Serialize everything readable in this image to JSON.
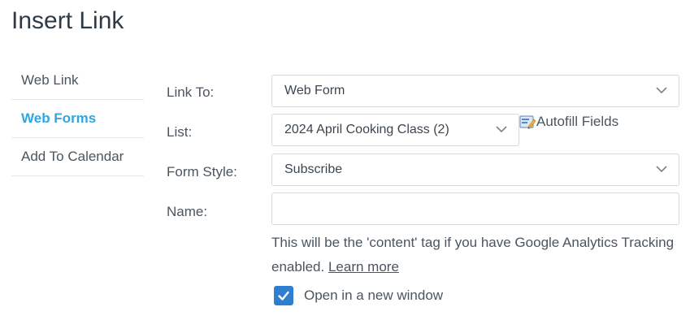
{
  "dialog": {
    "title": "Insert Link"
  },
  "sidebar": {
    "items": [
      {
        "label": "Web Link",
        "active": false
      },
      {
        "label": "Web Forms",
        "active": true
      },
      {
        "label": "Add To Calendar",
        "active": false
      }
    ]
  },
  "form": {
    "link_to": {
      "label": "Link To:",
      "value": "Web Form"
    },
    "list": {
      "label": "List:",
      "value": "2024 April Cooking Class (2)"
    },
    "form_style": {
      "label": "Form Style:",
      "value": "Subscribe"
    },
    "name": {
      "label": "Name:",
      "value": ""
    },
    "autofill_label": "Autofill Fields",
    "help_text": "This will be the 'content' tag if you have Google Analytics Tracking enabled.",
    "help_link": "Learn more",
    "open_new_window": {
      "label": "Open in a new window",
      "checked": true
    }
  },
  "colors": {
    "accent": "#2fa6df",
    "checkbox": "#2f7fd0",
    "title": "#2e3a46",
    "text": "#4a5560",
    "border": "#d5d9dd"
  },
  "icons": {
    "chevron": "chevron-down-icon",
    "autofill": "autofill-icon",
    "check": "checkmark-icon"
  }
}
